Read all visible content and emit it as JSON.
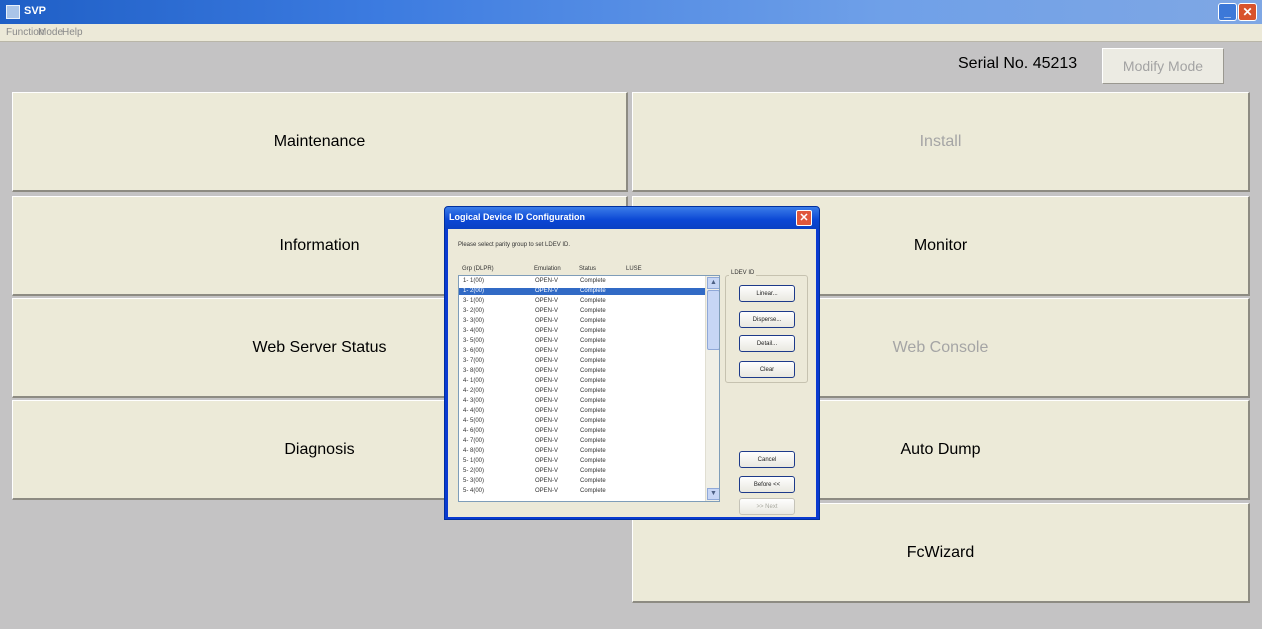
{
  "app": {
    "title": "SVP",
    "menu": [
      "Function",
      "Mode",
      "Help"
    ]
  },
  "header": {
    "serial": "Serial No. 45213",
    "modify_mode": "Modify Mode"
  },
  "buttons": {
    "maintenance": "Maintenance",
    "install": "Install",
    "information": "Information",
    "monitor": "Monitor",
    "web_server_status": "Web Server Status",
    "web_console": "Web Console",
    "diagnosis": "Diagnosis",
    "auto_dump": "Auto Dump",
    "fcwizard": "FcWizard"
  },
  "dialog": {
    "title": "Logical Device ID Configuration",
    "prompt": "Please select parity group to set LDEV ID.",
    "columns": [
      "Grp (DLPR)",
      "Emulation",
      "Status",
      "LUSE"
    ],
    "rows": [
      [
        "1- 1(00)",
        "OPEN-V",
        "Complete"
      ],
      [
        "1- 2(00)",
        "OPEN-V",
        "Complete"
      ],
      [
        "3- 1(00)",
        "OPEN-V",
        "Complete"
      ],
      [
        "3- 2(00)",
        "OPEN-V",
        "Complete"
      ],
      [
        "3- 3(00)",
        "OPEN-V",
        "Complete"
      ],
      [
        "3- 4(00)",
        "OPEN-V",
        "Complete"
      ],
      [
        "3- 5(00)",
        "OPEN-V",
        "Complete"
      ],
      [
        "3- 6(00)",
        "OPEN-V",
        "Complete"
      ],
      [
        "3- 7(00)",
        "OPEN-V",
        "Complete"
      ],
      [
        "3- 8(00)",
        "OPEN-V",
        "Complete"
      ],
      [
        "4- 1(00)",
        "OPEN-V",
        "Complete"
      ],
      [
        "4- 2(00)",
        "OPEN-V",
        "Complete"
      ],
      [
        "4- 3(00)",
        "OPEN-V",
        "Complete"
      ],
      [
        "4- 4(00)",
        "OPEN-V",
        "Complete"
      ],
      [
        "4- 5(00)",
        "OPEN-V",
        "Complete"
      ],
      [
        "4- 6(00)",
        "OPEN-V",
        "Complete"
      ],
      [
        "4- 7(00)",
        "OPEN-V",
        "Complete"
      ],
      [
        "4- 8(00)",
        "OPEN-V",
        "Complete"
      ],
      [
        "5- 1(00)",
        "OPEN-V",
        "Complete"
      ],
      [
        "5- 2(00)",
        "OPEN-V",
        "Complete"
      ],
      [
        "5- 3(00)",
        "OPEN-V",
        "Complete"
      ],
      [
        "5- 4(00)",
        "OPEN-V",
        "Complete"
      ]
    ],
    "selected_index": 1,
    "ldev_group": "LDEV ID",
    "linear": "Linear...",
    "disperse": "Disperse...",
    "detail": "Detail...",
    "clear": "Clear",
    "cancel": "Cancel",
    "before": "Before <<",
    "next": ">> Next"
  }
}
